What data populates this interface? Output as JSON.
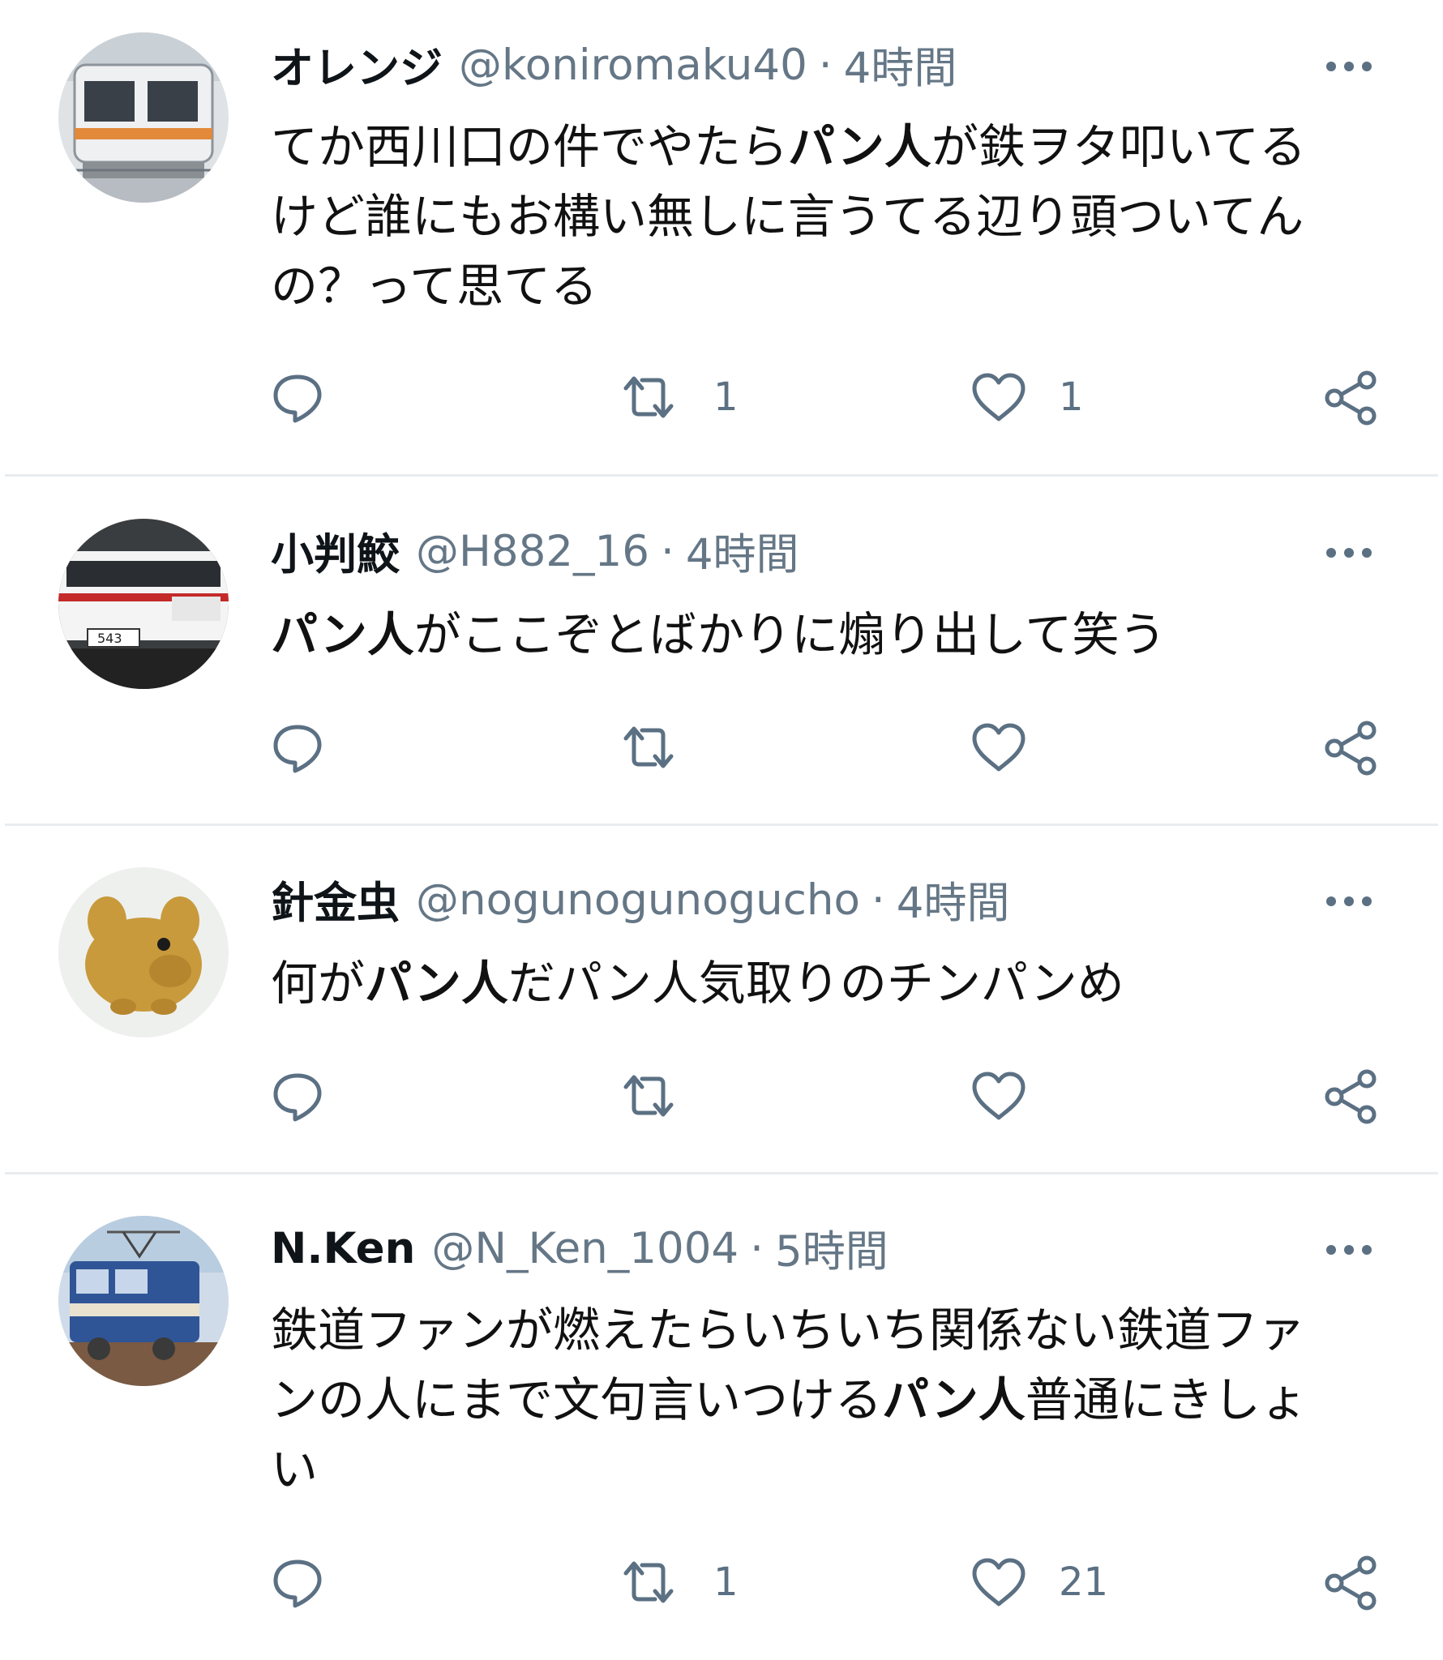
{
  "tweets": [
    {
      "name": "オレンジ",
      "handle": "@koniromaku40",
      "sep": "·",
      "time": "4時間",
      "text": [
        {
          "t": "てか西川口の件でやたら",
          "b": false
        },
        {
          "t": "パン人",
          "b": true
        },
        {
          "t": "が鉄ヲタ叩いてるけど誰にもお構い無しに言うてる辺り頭ついてんの？って思てる",
          "b": false
        }
      ],
      "retweets": "1",
      "likes": "1"
    },
    {
      "name": "小判鮫",
      "handle": "@H882_16",
      "sep": "·",
      "time": "4時間",
      "text": [
        {
          "t": "パン人",
          "b": true
        },
        {
          "t": "がここぞとばかりに煽り出して笑う",
          "b": false
        }
      ],
      "retweets": "",
      "likes": ""
    },
    {
      "name": "針金虫",
      "handle": "@nogunogunogucho",
      "sep": "·",
      "time": "4時間",
      "text": [
        {
          "t": "何が",
          "b": false
        },
        {
          "t": "パン人",
          "b": true
        },
        {
          "t": "だパン人気取りのチンパンめ",
          "b": false
        }
      ],
      "retweets": "",
      "likes": ""
    },
    {
      "name": "N.Ken",
      "handle": "@N_Ken_1004",
      "sep": "·",
      "time": "5時間",
      "text": [
        {
          "t": "鉄道ファンが燃えたらいちいち関係ない鉄道ファンの人にまで文句言いつける",
          "b": false
        },
        {
          "t": "パン人",
          "b": true
        },
        {
          "t": "普通にきしょい",
          "b": false
        }
      ],
      "retweets": "1",
      "likes": "21"
    }
  ],
  "icons": {
    "reply": "reply-bubble-icon",
    "retweet": "retweet-arrows-icon",
    "like": "heart-outline-icon",
    "share": "share-nodes-icon",
    "more": "more-dots-icon"
  },
  "colors": {
    "text": "#0f1419",
    "secondary": "#657786",
    "icon": "#5b7083",
    "divider": "#e9ecef"
  }
}
